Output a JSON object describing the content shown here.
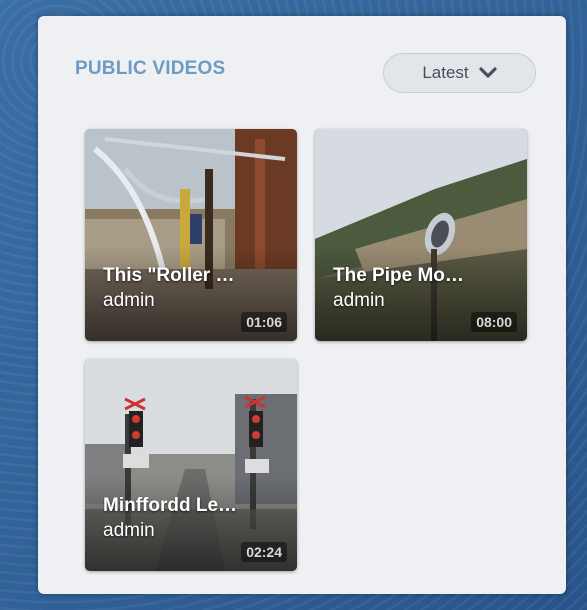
{
  "section": {
    "title": "PUBLIC VIDEOS",
    "sort_label": "Latest",
    "sort_icon": "chevron-down-icon"
  },
  "videos": [
    {
      "title": "This \"Roller …",
      "author": "admin",
      "duration": "01:06"
    },
    {
      "title": "The Pipe Mo…",
      "author": "admin",
      "duration": "08:00"
    },
    {
      "title": "Minffordd Le…",
      "author": "admin",
      "duration": "02:24"
    }
  ],
  "colors": {
    "title_accent": "#6f9bc2",
    "panel_bg": "#eef0f3",
    "page_bg": "#2f5f93"
  }
}
